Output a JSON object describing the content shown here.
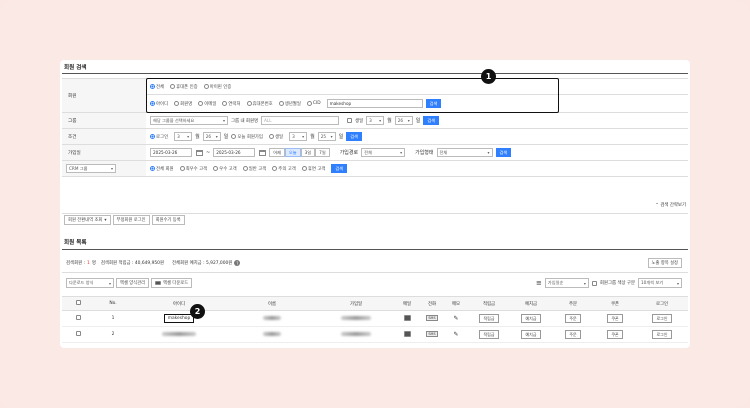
{
  "section_search": "회원 검색",
  "member": {
    "label": "회원",
    "scope_options": [
      "전체",
      "휴대폰 인증",
      "아이핀 인증"
    ],
    "field_options": [
      "아이디",
      "회원명",
      "이메일",
      "연락처",
      "휴대폰번호",
      "생년월일",
      "CID"
    ],
    "keyword": "makeshop",
    "search_label": "검색"
  },
  "group": {
    "label": "그룹",
    "select": "해당 그룹을 선택하세요",
    "in_group_label": "그룹 내 회원명",
    "in_group_placeholder": "ALL",
    "birth_label": "생일",
    "month": "3",
    "month_unit": "월",
    "day": "26",
    "day_unit": "일",
    "search_label": "검색"
  },
  "condition": {
    "label": "조건",
    "login_label": "로그인",
    "month": "3",
    "month_unit": "월",
    "day": "26",
    "day_unit": "일",
    "today_join": "오늘 회원가입",
    "birth_label": "생일",
    "month2": "3",
    "day2": "25",
    "search_label": "검색"
  },
  "joindate": {
    "label": "가입일",
    "from": "2025-03-26",
    "to": "2025-03-26",
    "quick": [
      "어제",
      "오늘",
      "3일",
      "7일"
    ],
    "path_label": "가입경로",
    "path_value": "전체",
    "type_label": "가입형태",
    "type_value": "전체",
    "search_label": "검색"
  },
  "crm": {
    "select": "CRM 그룹",
    "options": [
      "전체 회원",
      "최우수 고객",
      "우수 고객",
      "일반 고객",
      "주의 고객",
      "휴면 고객"
    ],
    "search_label": "검색"
  },
  "advanced": "검색 간략보기",
  "tools": [
    "회원 전환내역 조회",
    "부정회원 로그인",
    "회원수기 등록"
  ],
  "section_list": "회원 목록",
  "summary": {
    "search_count_label": "검색회원 :",
    "search_count": "1",
    "count_unit": "명",
    "points_label": "검색회원 적립금 : 40,649,950원",
    "deposit_label": "전체회원 예치금 : 5,927,000원",
    "help_icon": "question-icon"
  },
  "exposure_btn": "노출 항목 설정",
  "list_tools": {
    "download_format": "다운로드 양식",
    "excel_manage": "엑셀 양식관리",
    "excel_download": "엑셀 다운로드",
    "sort_value": "가입일순",
    "group_color": "회원그룹 색상 구분",
    "per_page": "10개씩 보기"
  },
  "columns": [
    "",
    "No.",
    "아이디",
    "이름",
    "가입일",
    "메일",
    "전화",
    "메모",
    "적립금",
    "예치금",
    "주문",
    "쿠폰",
    "로그인"
  ],
  "rows": [
    {
      "no": "1",
      "id": "makeshop",
      "points": "적립금",
      "deposit": "예치금",
      "order": "주문",
      "coupon": "쿠폰",
      "login": "로그인"
    },
    {
      "no": "2",
      "id": "",
      "points": "적립금",
      "deposit": "예치금",
      "order": "주문",
      "coupon": "쿠폰",
      "login": "로그인"
    }
  ],
  "badges": [
    "1",
    "2"
  ]
}
